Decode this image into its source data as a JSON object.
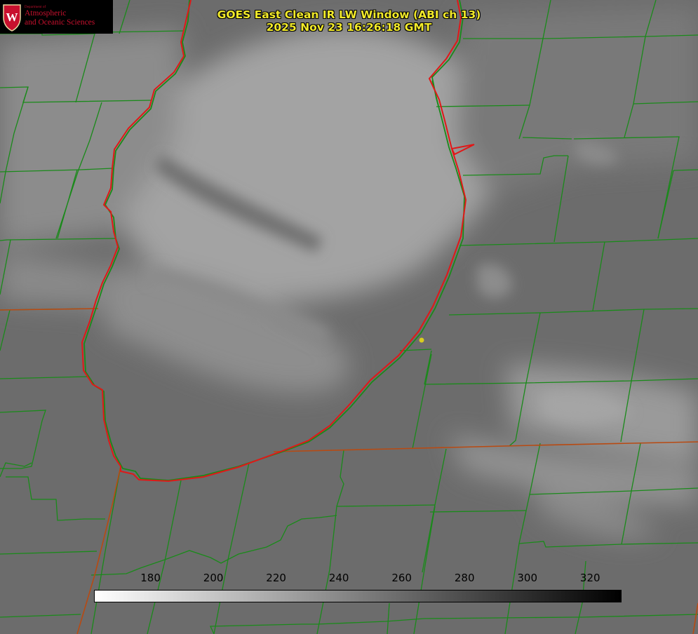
{
  "header": {
    "title_line1": "GOES East Clean IR LW Window (ABI ch 13)",
    "title_line2": "2025 Nov 23 16:26:18 GMT"
  },
  "logo": {
    "department": "Department of",
    "line1": "Atmospheric",
    "line2": "and Oceanic Sciences",
    "crest_letter": "W"
  },
  "colorbar": {
    "tick_labels": [
      "180",
      "200",
      "220",
      "240",
      "260",
      "280",
      "300",
      "320"
    ],
    "tick_values": [
      180,
      200,
      220,
      240,
      260,
      280,
      300,
      320
    ],
    "range": [
      162,
      330
    ],
    "colors": {
      "low": "#ffffff",
      "high": "#000000"
    }
  },
  "map": {
    "colors": {
      "county_lines": "#1a8a1a",
      "lake_outline": "#e01818",
      "state_lines": "#b84a12",
      "marker": "#d8cc20",
      "title_text": "#f2ea2a"
    }
  }
}
